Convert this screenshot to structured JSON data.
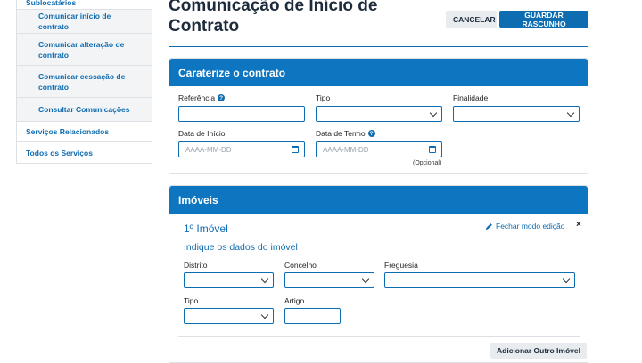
{
  "sidebar": {
    "parent_label": "Sublocatários",
    "sub_items": [
      {
        "label": "Comunicar início de contrato"
      },
      {
        "label": "Comunicar alteração de contrato"
      },
      {
        "label": "Comunicar cessação de contrato"
      },
      {
        "label": "Consultar Comunicações"
      }
    ],
    "top_items": [
      {
        "label": "Serviços Relacionados"
      },
      {
        "label": "Todos os Serviços"
      }
    ]
  },
  "header": {
    "title": "Comunicação de Início de Contrato",
    "cancel_label": "CANCELAR",
    "save_label": "GUARDAR RASCUNHO"
  },
  "contract": {
    "title": "Caraterize o contrato",
    "referencia_label": "Referência",
    "tipo_label": "Tipo",
    "finalidade_label": "Finalidade",
    "data_inicio_label": "Data de Início",
    "data_termo_label": "Data de Termo",
    "date_placeholder": "AAAA-MM-DD",
    "optional_label": "(Opcional)"
  },
  "imoveis": {
    "title": "Imóveis",
    "item_title": "1º Imóvel",
    "edit_label": "Fechar modo edição",
    "close_glyph": "×",
    "subtitle": "Indique os dados do imóvel",
    "distrito_label": "Distrito",
    "concelho_label": "Concelho",
    "freguesia_label": "Freguesia",
    "tipo_label": "Tipo",
    "artigo_label": "Artigo",
    "add_label": "Adicionar Outro Imóvel"
  },
  "icons": {
    "info": "info-icon",
    "calendar": "calendar-icon",
    "chevron": "chevron-down-icon",
    "pencil": "pencil-icon"
  },
  "colors": {
    "primary": "#0e6cb0",
    "header_bar": "#0e76c0",
    "neutral_button": "#e9ecef",
    "title_text": "#1e2b3c"
  }
}
